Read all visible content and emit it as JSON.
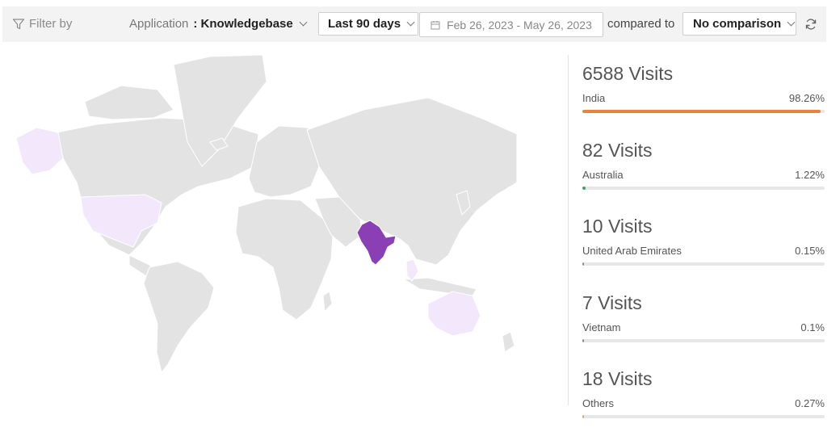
{
  "toolbar": {
    "filter_label": "Filter by",
    "application_label": "Application",
    "application_value": ": Knowledgebase",
    "period": "Last 90 days",
    "date_range": "Feb 26, 2023 - May 26, 2023",
    "compared_label": "compared to",
    "comparison": "No comparison"
  },
  "stats": [
    {
      "visits": "6588 Visits",
      "country": "India",
      "percent": "98.26%",
      "fraction": 0.9826,
      "color": "#e8823f"
    },
    {
      "visits": "82 Visits",
      "country": "Australia",
      "percent": "1.22%",
      "fraction": 0.0122,
      "color": "#3aa55a"
    },
    {
      "visits": "10 Visits",
      "country": "United Arab Emirates",
      "percent": "0.15%",
      "fraction": 0.0015,
      "color": "#8c8c8c"
    },
    {
      "visits": "7 Visits",
      "country": "Vietnam",
      "percent": "0.1%",
      "fraction": 0.001,
      "color": "#8c8c8c"
    },
    {
      "visits": "18 Visits",
      "country": "Others",
      "percent": "0.27%",
      "fraction": 0.0027,
      "color": "#c9b26b"
    }
  ],
  "map": {
    "base_color": "#e3e3e3",
    "highlight_color": "#8a3fb5",
    "light_color": "#f3e7fc"
  }
}
